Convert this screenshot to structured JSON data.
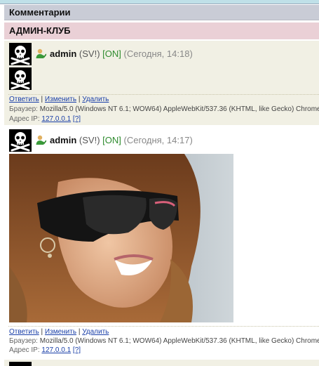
{
  "header": {
    "title": "Комментарии"
  },
  "club": {
    "title": "АДМИН-КЛУБ"
  },
  "posts": [
    {
      "author": "admin",
      "rank": "(SV!)",
      "status": "[ON]",
      "date": "(Сегодня, 14:18)",
      "actions": {
        "reply": "Ответить",
        "edit": "Изменить",
        "delete": "Удалить",
        "sep1": "|",
        "sep2": "|"
      },
      "browser_label": "Браузер:",
      "browser": "Mozilla/5.0 (Windows NT 6.1; WOW64) AppleWebKit/537.36 (KHTML, like Gecko) Chrome",
      "ip_label": "Адрес IP:",
      "ip": "127.0.0.1",
      "ip_help": "[?]"
    },
    {
      "author": "admin",
      "rank": "(SV!)",
      "status": "[ON]",
      "date": "(Сегодня, 14:17)",
      "actions": {
        "reply": "Ответить",
        "edit": "Изменить",
        "delete": "Удалить",
        "sep1": "|",
        "sep2": "|"
      },
      "browser_label": "Браузер:",
      "browser": "Mozilla/5.0 (Windows NT 6.1; WOW64) AppleWebKit/537.36 (KHTML, like Gecko) Chrome",
      "ip_label": "Адрес IP:",
      "ip": "127.0.0.1",
      "ip_help": "[?]"
    }
  ],
  "icons": {
    "avatar": "skull-crossbones-icon",
    "user": "user-online-icon"
  },
  "colors": {
    "header_bg": "#c9ccd6",
    "club_bg": "#ead0d6",
    "post_bg": "#f1f0e4",
    "online": "#2e8b2e",
    "link": "#1a3fa8"
  }
}
